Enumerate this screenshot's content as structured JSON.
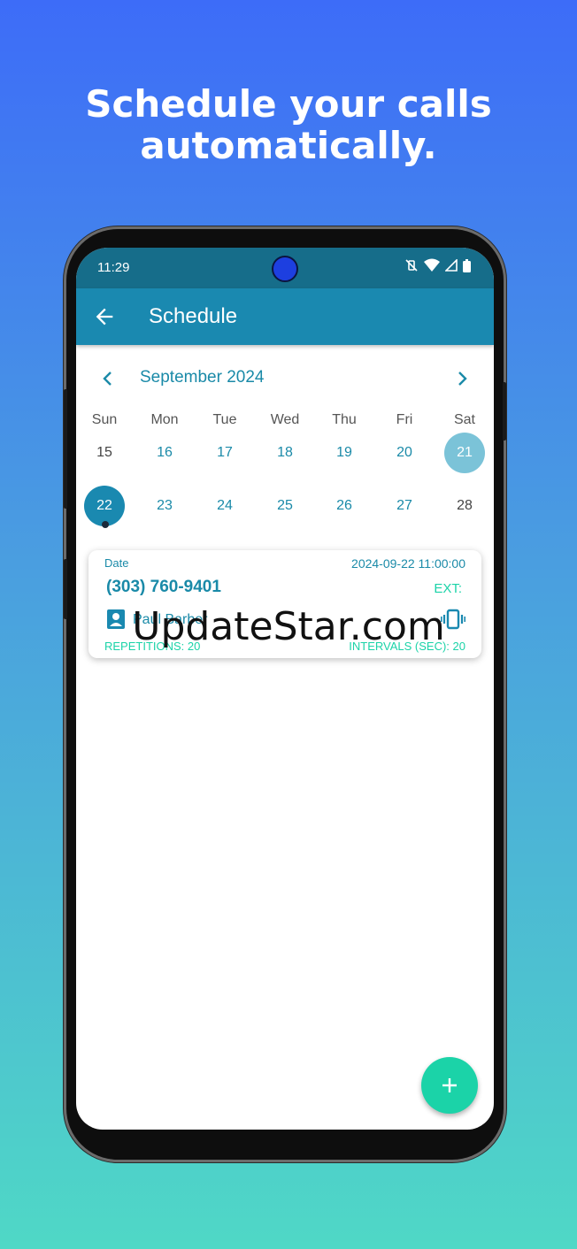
{
  "promo": {
    "headline_line1": "Schedule your calls",
    "headline_line2": "automatically."
  },
  "status_bar": {
    "time": "11:29"
  },
  "app_bar": {
    "title": "Schedule"
  },
  "calendar": {
    "month_label": "September 2024",
    "weekdays": [
      "Sun",
      "Mon",
      "Tue",
      "Wed",
      "Thu",
      "Fri",
      "Sat"
    ],
    "week1": [
      "15",
      "16",
      "17",
      "18",
      "19",
      "20",
      "21"
    ],
    "week2": [
      "22",
      "23",
      "24",
      "25",
      "26",
      "27",
      "28"
    ],
    "selected_day": "22",
    "today_day": "21"
  },
  "call_card": {
    "date_label": "Date",
    "datetime": "2024-09-22 11:00:00",
    "phone": "(303) 760-9401",
    "ext_label": "EXT:",
    "contact_name": "Paul Barber",
    "repetitions": "REPETITIONS: 20",
    "intervals": "INTERVALS (SEC): 20"
  },
  "watermark": "UpdateStar.com",
  "colors": {
    "primary": "#1a89b0",
    "status_bar": "#166d8a",
    "accent": "#1bd3a8",
    "link": "#1a8aa8"
  }
}
